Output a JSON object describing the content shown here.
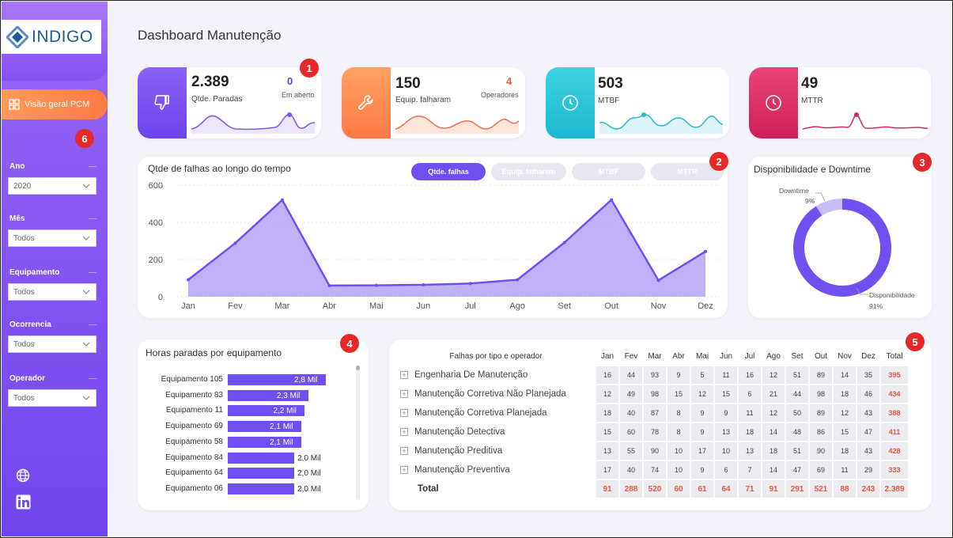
{
  "brand": {
    "logo_text": "INDIGO"
  },
  "nav": {
    "visao_label": "Visão geral PCM"
  },
  "page_title": "Dashboard Manutenção",
  "badges": [
    "1",
    "2",
    "3",
    "4",
    "5",
    "6"
  ],
  "filters": [
    {
      "label": "Ano",
      "value": "2020"
    },
    {
      "label": "Mês",
      "value": "Todos"
    },
    {
      "label": "Equipamento",
      "value": "Todos"
    },
    {
      "label": "Ocorrencia",
      "value": "Todos"
    },
    {
      "label": "Operador",
      "value": "Todos"
    }
  ],
  "kpis": [
    {
      "value": "2.389",
      "label": "Qtde. Paradas",
      "sub_value": "0",
      "sub_label": "Em aberto",
      "color": "#7b55f0",
      "sub_color": "#5b3ff0"
    },
    {
      "value": "150",
      "label": "Equip. falharam",
      "sub_value": "4",
      "sub_label": "Operadores",
      "color": "#ff8550",
      "sub_color": "#ea5a35"
    },
    {
      "value": "503",
      "label": "MTBF",
      "color": "#2bc7d8"
    },
    {
      "value": "49",
      "label": "MTTR",
      "color": "#dd2e66"
    }
  ],
  "line_panel": {
    "title": "Qtde de falhas ao longo do tempo",
    "tabs": [
      "Qtde. falhas",
      "Equip. falharam",
      "MTBF",
      "MTTR"
    ],
    "active_tab": 0
  },
  "donut_panel": {
    "title": "Disponibilidade e Downtime",
    "downtime_label": "Downtime",
    "downtime_pct": "9%",
    "disp_label": "Disponibilidade",
    "disp_pct": "91%"
  },
  "bar_panel": {
    "title": "Horas paradas por equipamento"
  },
  "matrix": {
    "title": "Falhas por tipo e operador",
    "months": [
      "Jan",
      "Fev",
      "Mar",
      "Abr",
      "Mai",
      "Jun",
      "Jul",
      "Ago",
      "Set",
      "Out",
      "Nov",
      "Dez",
      "Total"
    ],
    "rows": [
      {
        "label": "Engenharia De Manutenção",
        "values": [
          "16",
          "44",
          "93",
          "9",
          "5",
          "11",
          "16",
          "12",
          "51",
          "89",
          "14",
          "35",
          "395"
        ]
      },
      {
        "label": "Manutenção Corretiva Não Planejada",
        "values": [
          "12",
          "49",
          "98",
          "15",
          "12",
          "15",
          "6",
          "21",
          "44",
          "98",
          "18",
          "46",
          "434"
        ]
      },
      {
        "label": "Manutenção Corretiva Planejada",
        "values": [
          "18",
          "40",
          "87",
          "8",
          "9",
          "9",
          "11",
          "12",
          "50",
          "89",
          "12",
          "43",
          "388"
        ]
      },
      {
        "label": "Manutenção Detectiva",
        "values": [
          "15",
          "60",
          "78",
          "8",
          "9",
          "13",
          "18",
          "14",
          "48",
          "86",
          "15",
          "47",
          "411"
        ]
      },
      {
        "label": "Manutenção Preditiva",
        "values": [
          "13",
          "55",
          "90",
          "10",
          "17",
          "10",
          "13",
          "18",
          "51",
          "90",
          "18",
          "43",
          "428"
        ]
      },
      {
        "label": "Manutenção Preventiva",
        "values": [
          "17",
          "40",
          "74",
          "10",
          "9",
          "6",
          "7",
          "14",
          "47",
          "69",
          "11",
          "29",
          "333"
        ]
      }
    ],
    "total": {
      "label": "Total",
      "values": [
        "91",
        "288",
        "520",
        "60",
        "61",
        "64",
        "71",
        "91",
        "291",
        "521",
        "88",
        "243",
        "2.389"
      ]
    }
  },
  "chart_data": [
    {
      "type": "area",
      "title": "Qtde de falhas ao longo do tempo",
      "categories": [
        "Jan",
        "Fev",
        "Mar",
        "Abr",
        "Mai",
        "Jun",
        "Jul",
        "Ago",
        "Set",
        "Out",
        "Nov",
        "Dez"
      ],
      "values": [
        91,
        288,
        520,
        60,
        61,
        64,
        71,
        91,
        291,
        521,
        88,
        243
      ],
      "ylim": [
        0,
        600
      ],
      "yticks": [
        "0",
        "200",
        "400",
        "600"
      ],
      "grid": true,
      "color": "#6f4ff0"
    },
    {
      "type": "pie",
      "title": "Disponibilidade e Downtime",
      "categories": [
        "Disponibilidade",
        "Downtime"
      ],
      "values": [
        91,
        9
      ],
      "colors": [
        "#7050f0",
        "#c9bdf7"
      ]
    },
    {
      "type": "bar",
      "title": "Horas paradas por equipamento",
      "categories": [
        "Equipamento 105",
        "Equipamento 83",
        "Equipamento 11",
        "Equipamento 69",
        "Equipamento 58",
        "Equipamento 84",
        "Equipamento 64",
        "Equipamento 06"
      ],
      "values": [
        2800,
        2300,
        2200,
        2100,
        2100,
        2000,
        2000,
        2000
      ],
      "value_labels": [
        "2,8 Mil",
        "2,3 Mil",
        "2,2 Mil",
        "2,1 Mil",
        "2,1 Mil",
        "2,0 Mil",
        "2,0 Mil",
        "2,0 Mil"
      ],
      "xlim": [
        0,
        2800
      ]
    }
  ]
}
